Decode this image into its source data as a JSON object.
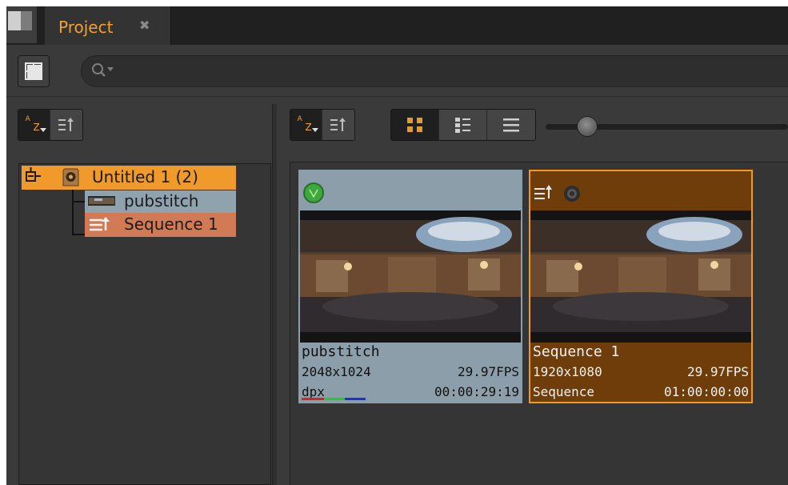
{
  "tab": {
    "title": "Project",
    "close_glyph": "✖"
  },
  "search": {
    "placeholder": ""
  },
  "left_sort": {
    "az_a": "A",
    "az_z": "Z"
  },
  "tree": {
    "root": "Untitled 1 (2)",
    "items": [
      {
        "label": "pubstitch"
      },
      {
        "label": "Sequence 1"
      }
    ]
  },
  "clips": [
    {
      "name": "pubstitch",
      "resolution": "2048x1024",
      "fps": "29.97FPS",
      "format": "dpx",
      "timecode": "00:00:29:19"
    },
    {
      "name": "Sequence 1",
      "resolution": "1920x1080",
      "fps": "29.97FPS",
      "format": "Sequence",
      "timecode": "01:00:00:00"
    }
  ],
  "view": {
    "thumbnail_size": 0.14
  },
  "colors": {
    "accent": "#f3a12c",
    "tree_root_bg": "#ef9a2a",
    "tree_clip_bg": "#8fa2ad",
    "tree_seq_bg": "#d27a55",
    "seq_card_bg": "#6e3d09"
  },
  "icons": {
    "project_tab": "window-icon",
    "layout": "grid-layout-icon",
    "search": "search-icon",
    "sort_name": "sort-az-icon",
    "sort_order": "sort-order-icon",
    "view_large": "large-thumbnails-icon",
    "view_small": "small-thumbnails-icon",
    "view_list": "list-view-icon",
    "clip_status": "green-status-icon",
    "sequence": "sequence-icon"
  }
}
